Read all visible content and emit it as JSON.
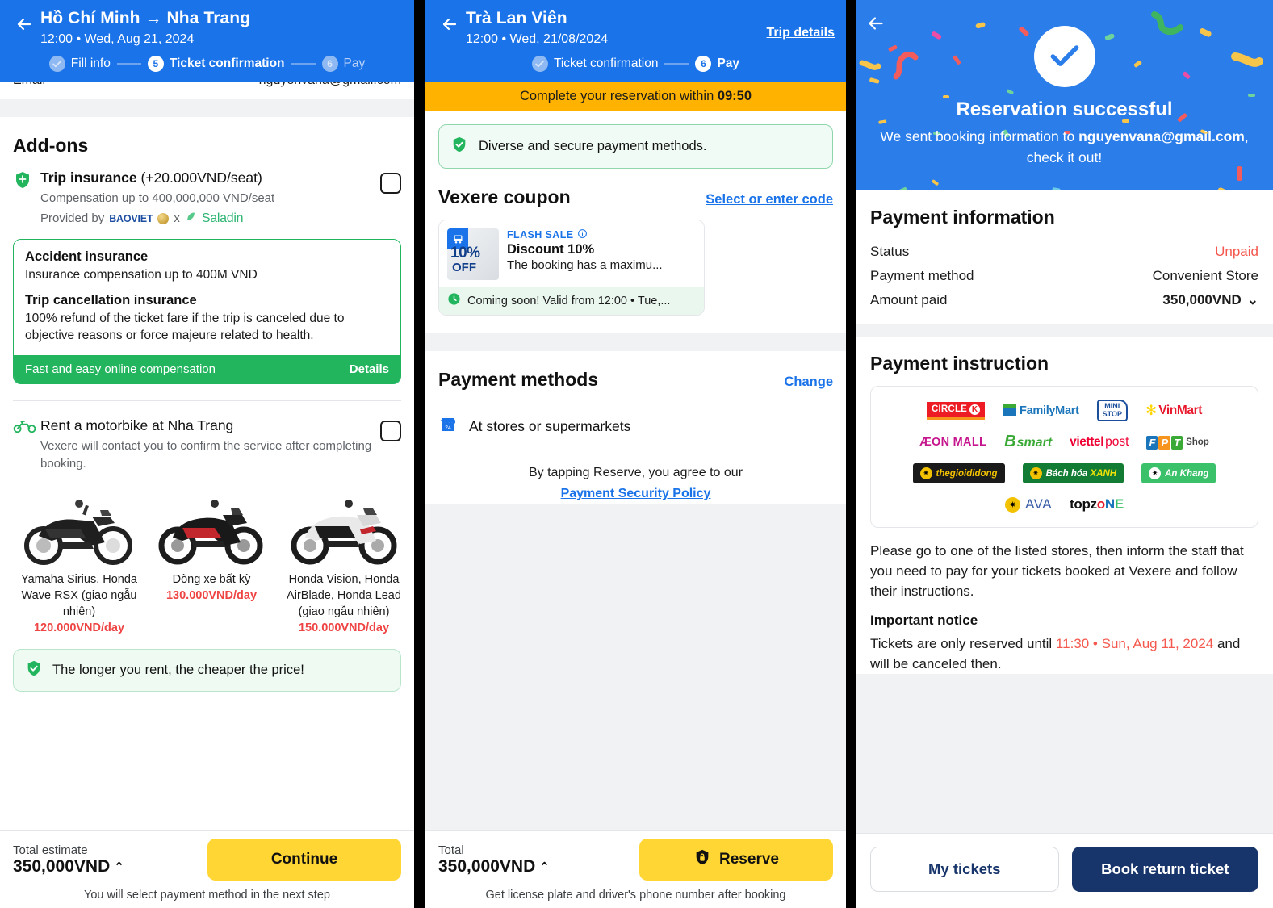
{
  "panel1": {
    "header": {
      "back_icon": "arrow-left-icon",
      "title": "Hồ Chí Minh → Nha Trang",
      "subtitle": "12:00 • Wed, Aug 21, 2024",
      "steps": [
        {
          "badge": "✓",
          "label": "Fill info",
          "state": "done"
        },
        {
          "badge": "5",
          "label": "Ticket confirmation",
          "state": "active"
        },
        {
          "badge": "6",
          "label": "Pay",
          "state": "idle"
        }
      ]
    },
    "clipped_row": {
      "label": "Email",
      "value": "nguyenvana@gmail.com"
    },
    "addons_title": "Add-ons",
    "trip_insurance": {
      "icon": "shield-icon",
      "name": "Trip insurance",
      "price_suffix": "(+20.000VND/seat)",
      "compensation": "Compensation up to 400,000,000 VND/seat",
      "provided_by_label": "Provided by",
      "provider_1": "BAOVIET",
      "provider_sep": "x",
      "provider_2": "Saladin",
      "checkbox_checked": false
    },
    "insurance_card": {
      "accident_title": "Accident insurance",
      "accident_desc": "Insurance compensation up to 400M VND",
      "cancel_title": "Trip cancellation insurance",
      "cancel_desc": "100% refund of the ticket fare if the trip is canceled due to objective reasons or force majeure related to health.",
      "footer_text": "Fast and easy online compensation",
      "footer_link": "Details"
    },
    "motorbike": {
      "icon": "motorbike-icon",
      "title": "Rent a motorbike at Nha Trang",
      "desc": "Vexere will contact you to confirm the service after completing booking.",
      "checkbox_checked": false,
      "options": [
        {
          "name": "Yamaha Sirius, Honda Wave RSX (giao ngẫu nhiên)",
          "price": "120.000VND/day"
        },
        {
          "name": "Dòng xe bất kỳ",
          "price": "130.000VND/day"
        },
        {
          "name": "Honda Vision, Honda AirBlade, Honda Lead (giao ngẫu nhiên)",
          "price": "150.000VND/day"
        }
      ],
      "tip_icon": "check-shield-icon",
      "tip": "The longer you rent, the cheaper the price!"
    },
    "bottom": {
      "total_label": "Total estimate",
      "total_value": "350,000VND",
      "caret": "⌃",
      "button": "Continue",
      "note": "You will select payment method in the next step"
    }
  },
  "panel2": {
    "header": {
      "back_icon": "arrow-left-icon",
      "title": "Trà Lan Viên",
      "subtitle": "12:00 • Wed, 21/08/2024",
      "trip_details": "Trip details",
      "steps": [
        {
          "badge": "✓",
          "label": "Ticket confirmation",
          "state": "done"
        },
        {
          "badge": "6",
          "label": "Pay",
          "state": "active"
        }
      ]
    },
    "timer": {
      "prefix": "Complete your reservation within ",
      "value": "09:50"
    },
    "secure_note": {
      "icon": "check-shield-icon",
      "text": "Diverse and secure payment methods."
    },
    "coupon_section": {
      "title": "Vexere coupon",
      "action": "Select or enter code",
      "card": {
        "thumb_percent": "10%",
        "thumb_off": "OFF",
        "thumb_icon": "bus-icon",
        "flash_label": "FLASH SALE",
        "info_icon": "info-icon",
        "title": "Discount 10%",
        "desc": "The booking has a maximu...",
        "footer_icon": "clock-icon",
        "footer": "Coming soon! Valid from 12:00 • Tue,..."
      }
    },
    "payment_section": {
      "title": "Payment methods",
      "change": "Change",
      "method_icon": "store-icon",
      "method": "At stores or supermarkets",
      "agree_prefix": "By tapping Reserve, you agree to our",
      "agree_link": "Payment Security Policy"
    },
    "bottom": {
      "total_label": "Total",
      "total_value": "350,000VND",
      "caret": "⌃",
      "button": "Reserve",
      "button_icon": "lock-shield-icon",
      "note": "Get license plate and driver's phone number after booking"
    }
  },
  "panel3": {
    "hero": {
      "back_icon": "arrow-left-icon",
      "check_icon": "check-circle-icon",
      "title": "Reservation successful",
      "sub_prefix": "We sent booking information to ",
      "email": "nguyenvana@gmail.com",
      "sub_suffix": ", check it out!"
    },
    "payment_info": {
      "title": "Payment information",
      "rows": [
        {
          "label": "Status",
          "value": "Unpaid",
          "style": "red"
        },
        {
          "label": "Payment method",
          "value": "Convenient Store",
          "style": "plain"
        },
        {
          "label": "Amount paid",
          "value": "350,000VND",
          "style": "strong",
          "caret": "⌄"
        }
      ]
    },
    "instruction": {
      "title": "Payment instruction",
      "logos": [
        [
          "Circle K",
          "FamilyMart",
          "MINI STOP",
          "VinMart"
        ],
        [
          "ÆON MALL",
          "B's mart",
          "viettel post",
          "FPT Shop"
        ],
        [
          "thegioididong",
          "Bách hóa XANH",
          "An Khang"
        ],
        [
          "AVA",
          "topzone"
        ]
      ],
      "body": "Please go to one of the listed stores, then inform the staff that you need to pay for your tickets booked at Vexere and follow their instructions.",
      "notice_title": "Important notice",
      "notice_prefix": "Tickets are only reserved until ",
      "notice_deadline": "11:30 • Sun, Aug 11, 2024",
      "notice_suffix": " and will be canceled then."
    },
    "bottom": {
      "secondary": "My tickets",
      "primary": "Book return ticket"
    }
  },
  "colors": {
    "blue": "#1a73e8",
    "hero_blue": "#2b7de9",
    "yellow": "#ffd633",
    "green": "#22b55e",
    "red": "#ef4444",
    "navy": "#17356b",
    "amber": "#ffb300"
  }
}
